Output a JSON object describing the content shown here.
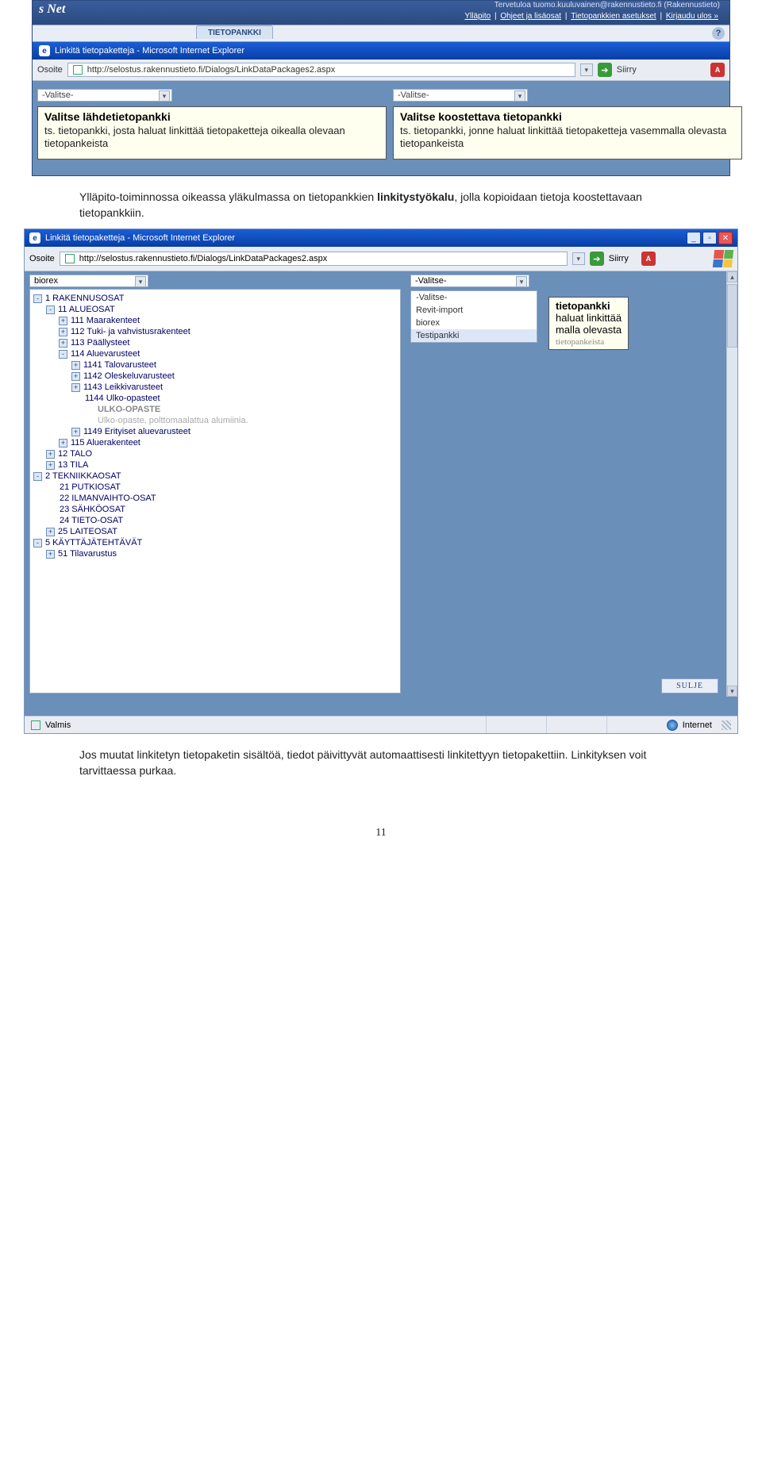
{
  "shot1": {
    "banner": {
      "logo": "s Net",
      "greeting": "Tervetuloa tuomo.kuuluvainen@rakennustieto.fi (Rakennustieto)",
      "links": [
        "Ylläpito",
        "Ohjeet ja lisäosat",
        "Tietopankkien asetukset",
        "Kirjaudu ulos »"
      ]
    },
    "tab": "TIETOPANKKI",
    "ieTitle": "Linkitä tietopaketteja - Microsoft Internet Explorer",
    "addr": {
      "label": "Osoite",
      "url": "http://selostus.rakennustieto.fi/Dialogs/LinkDataPackages2.aspx",
      "go": "Siirry"
    },
    "leftSelect": "-Valitse-",
    "rightSelect": "-Valitse-",
    "leftCard": {
      "h": "Valitse lähdetietopankki",
      "p": "ts. tietopankki, josta haluat linkittää tietopaketteja oikealla olevaan tietopankeista"
    },
    "rightCard": {
      "h": "Valitse koostettava tietopankki",
      "p": "ts. tietopankki, jonne haluat linkittää tietopaketteja vasemmalla olevasta tietopankeista"
    }
  },
  "para1": {
    "pre": "Ylläpito-toiminnossa oikeassa yläkulmassa on tietopankkien ",
    "b": "linkitystyökalu",
    "post": ", jolla kopioidaan tietoja koostettavaan tietopankkiin."
  },
  "shot2": {
    "ieTitle": "Linkitä tietopaketteja - Microsoft Internet Explorer",
    "addr": {
      "label": "Osoite",
      "url": "http://selostus.rakennustieto.fi/Dialogs/LinkDataPackages2.aspx",
      "go": "Siirry"
    },
    "leftSelect": "biorex",
    "rightSelect": "-Valitse-",
    "dropdown": [
      "-Valitse-",
      "Revit-import",
      "biorex",
      "Testipankki"
    ],
    "peek": {
      "h": "tietopankki",
      "l1": "haluat linkittää",
      "l2": "malla olevasta",
      "cut": "tietopankeista"
    },
    "tree": [
      {
        "i": 0,
        "s": "-",
        "t": "1 RAKENNUSOSAT"
      },
      {
        "i": 1,
        "s": "-",
        "t": "11 ALUEOSAT"
      },
      {
        "i": 2,
        "s": "+",
        "t": "111 Maarakenteet"
      },
      {
        "i": 2,
        "s": "+",
        "t": "112 Tuki- ja vahvistusrakenteet"
      },
      {
        "i": 2,
        "s": "+",
        "t": "113 Päällysteet"
      },
      {
        "i": 2,
        "s": "-",
        "t": "114 Aluevarusteet"
      },
      {
        "i": 3,
        "s": "+",
        "t": "1141 Talovarusteet"
      },
      {
        "i": 3,
        "s": "+",
        "t": "1142 Oleskeluvarusteet"
      },
      {
        "i": 3,
        "s": "+",
        "t": "1143 Leikkivarusteet"
      },
      {
        "i": 3,
        "s": "",
        "t": "1144 Ulko-opasteet"
      },
      {
        "i": 4,
        "s": "",
        "t": "ULKO-OPASTE",
        "gray": true
      },
      {
        "i": 4,
        "s": "",
        "t": "Ulko-opaste, polttomaalattua alumiinia.",
        "lite": true
      },
      {
        "i": 3,
        "s": "+",
        "t": "1149 Erityiset aluevarusteet"
      },
      {
        "i": 2,
        "s": "+",
        "t": "115 Aluerakenteet"
      },
      {
        "i": 1,
        "s": "+",
        "t": "12 TALO"
      },
      {
        "i": 1,
        "s": "+",
        "t": "13 TILA"
      },
      {
        "i": 0,
        "s": "-",
        "t": "2 TEKNIIKKAOSAT"
      },
      {
        "i": 1,
        "s": "",
        "t": "21 PUTKIOSAT"
      },
      {
        "i": 1,
        "s": "",
        "t": "22 ILMANVAIHTO-OSAT"
      },
      {
        "i": 1,
        "s": "",
        "t": "23 SÄHKÖOSAT"
      },
      {
        "i": 1,
        "s": "",
        "t": "24 TIETO-OSAT"
      },
      {
        "i": 1,
        "s": "+",
        "t": "25 LAITEOSAT"
      },
      {
        "i": 0,
        "s": "-",
        "t": "5 KÄYTTÄJÄTEHTÄVÄT"
      },
      {
        "i": 1,
        "s": "+",
        "t": "51 Tilavarustus"
      }
    ],
    "closeBtn": "SULJE",
    "status": {
      "ready": "Valmis",
      "zone": "Internet"
    }
  },
  "para2": "Jos muutat linkitetyn tietopaketin sisältöä, tiedot päivittyvät automaattisesti linkitettyyn tietopakettiin. Linkityksen voit tarvittaessa purkaa.",
  "pageNum": "11"
}
